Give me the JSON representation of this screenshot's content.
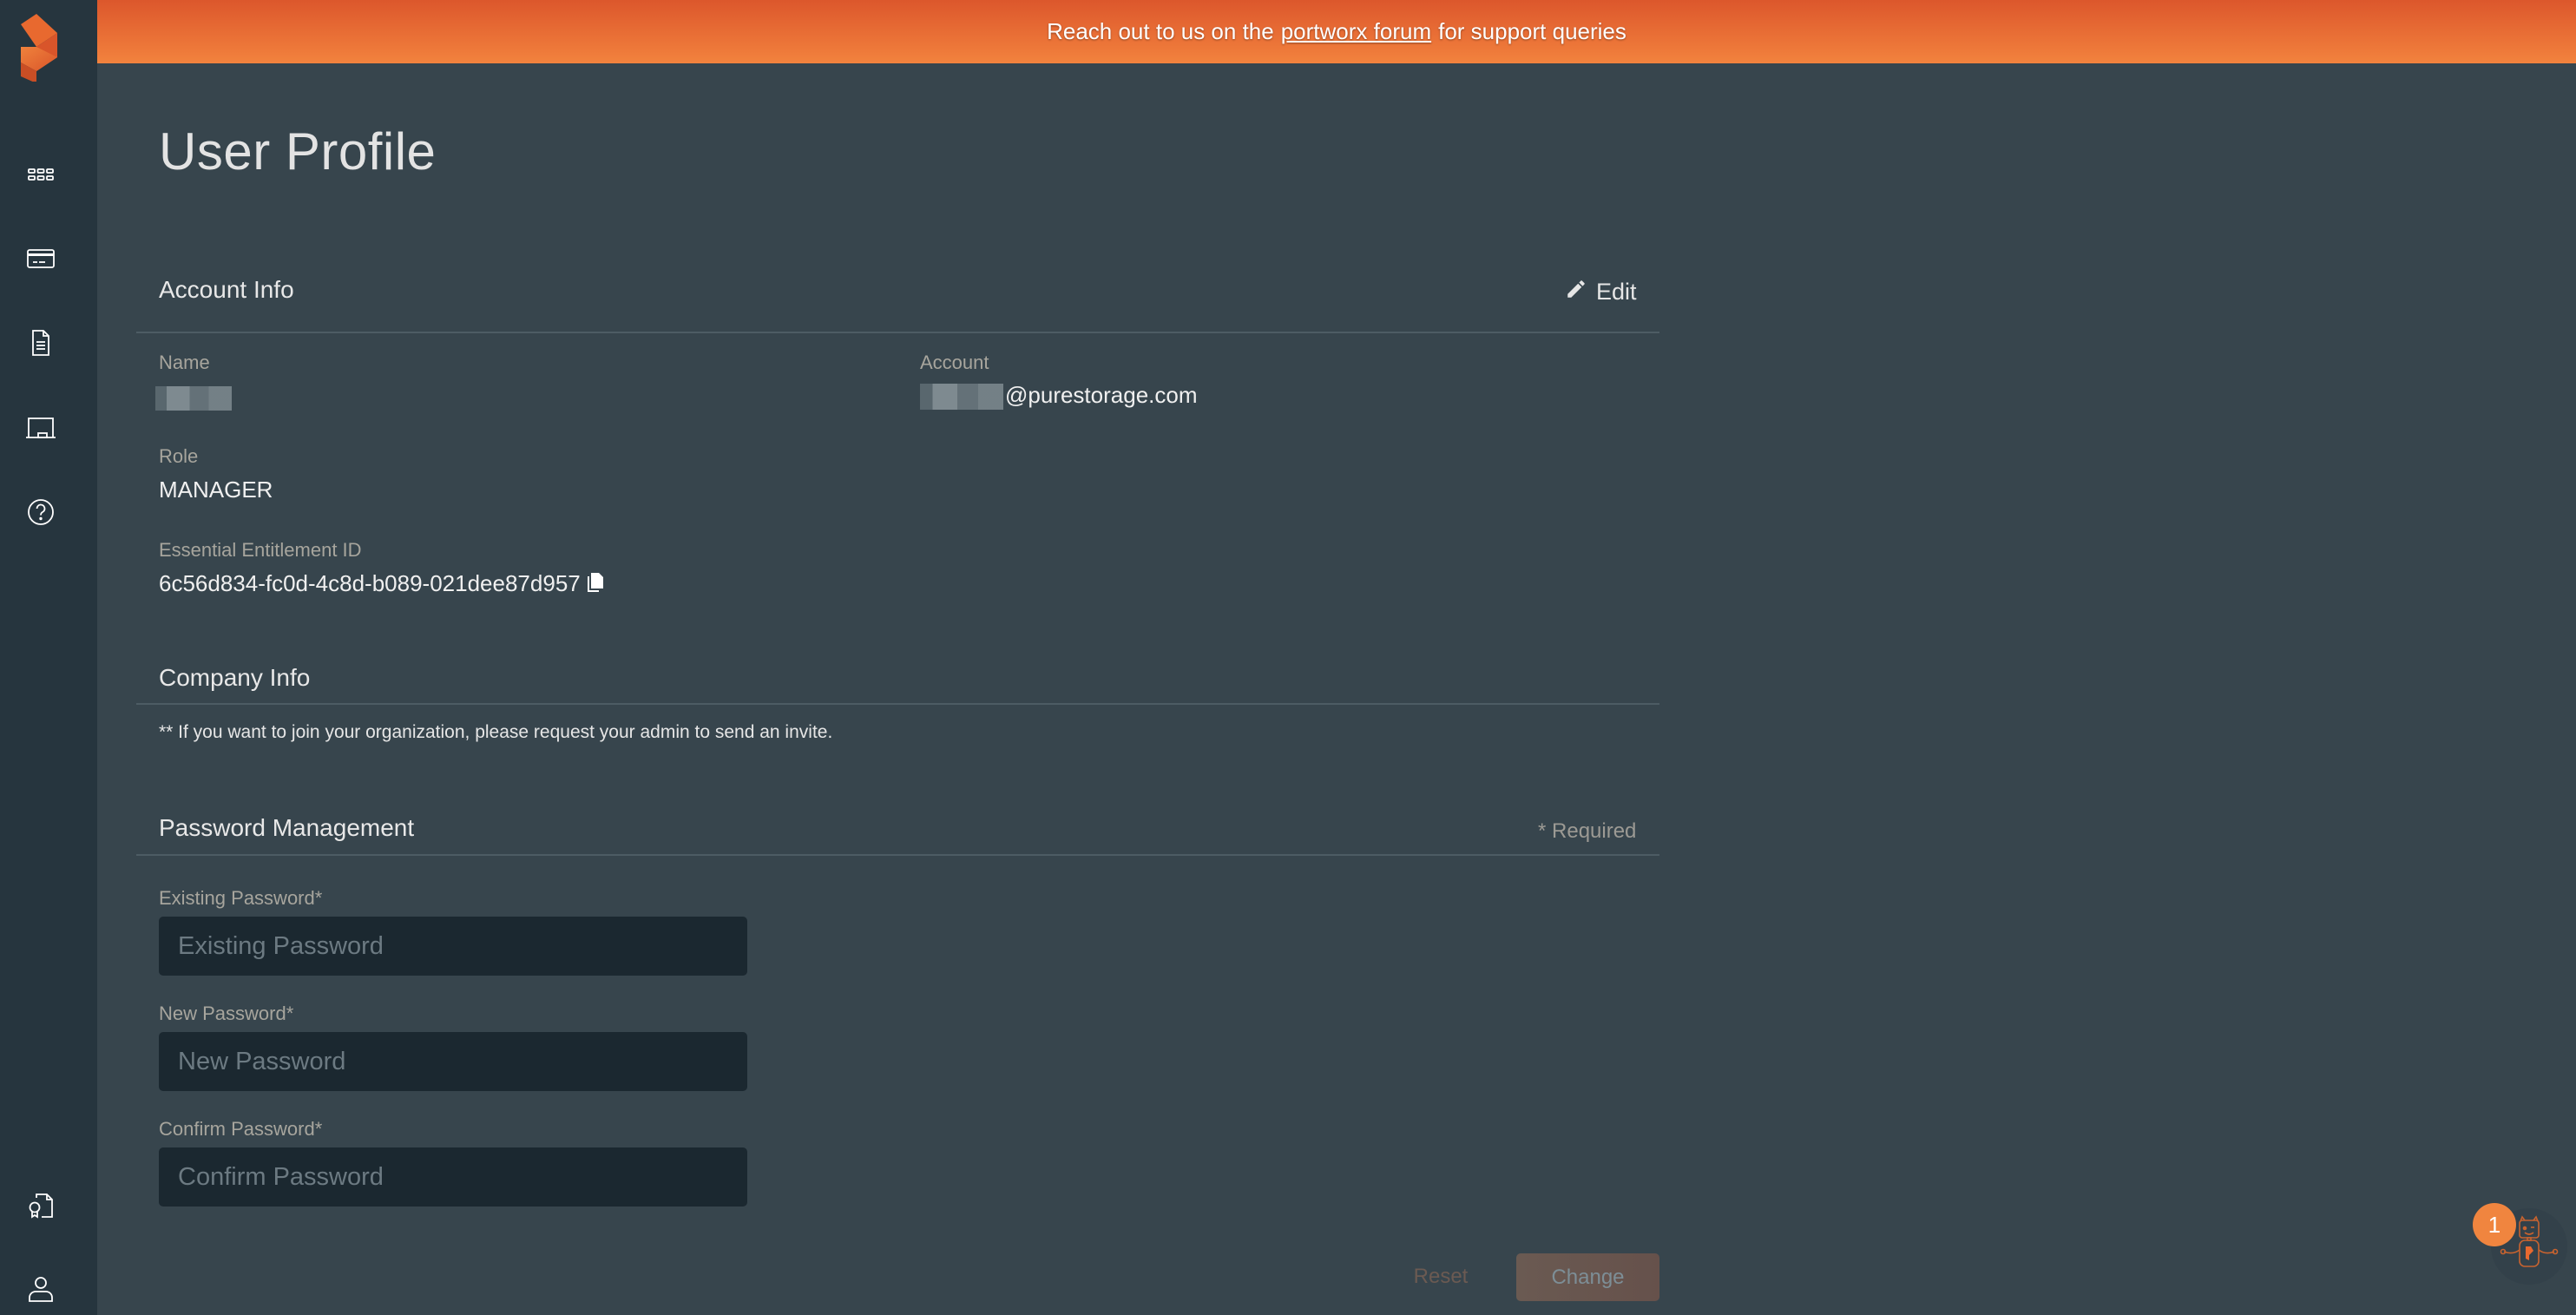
{
  "banner": {
    "prefix": "Reach out to us on the",
    "link_label": "portworx forum",
    "suffix": "for support queries"
  },
  "sidebar": {
    "items": [
      {
        "icon": "apps-grid-icon",
        "name": "sidebar-item-apps"
      },
      {
        "icon": "credit-card-icon",
        "name": "sidebar-item-billing"
      },
      {
        "icon": "document-icon",
        "name": "sidebar-item-documents"
      },
      {
        "icon": "presentation-board-icon",
        "name": "sidebar-item-training"
      },
      {
        "icon": "help-circle-icon",
        "name": "sidebar-item-help"
      }
    ],
    "bottom_items": [
      {
        "icon": "certificate-icon",
        "name": "sidebar-item-licenses"
      },
      {
        "icon": "user-icon",
        "name": "sidebar-item-profile"
      }
    ]
  },
  "page": {
    "title": "User Profile"
  },
  "account_info": {
    "heading": "Account Info",
    "edit_label": "Edit",
    "name_label": "Name",
    "name_value": "",
    "account_label": "Account",
    "account_value_suffix": "@purestorage.com",
    "role_label": "Role",
    "role_value": "MANAGER",
    "entitlement_label": "Essential Entitlement ID",
    "entitlement_value": "6c56d834-fc0d-4c8d-b089-021dee87d957"
  },
  "company_info": {
    "heading": "Company Info",
    "note": "** If you want to join your organization, please request your admin to send an invite."
  },
  "password_management": {
    "heading": "Password Management",
    "required_note": "* Required",
    "fields": [
      {
        "label": "Existing Password*",
        "placeholder": "Existing Password",
        "value": ""
      },
      {
        "label": "New Password*",
        "placeholder": "New Password",
        "value": ""
      },
      {
        "label": "Confirm Password*",
        "placeholder": "Confirm Password",
        "value": ""
      }
    ],
    "reset_label": "Reset",
    "change_label": "Change"
  },
  "chat": {
    "badge_count": "1"
  },
  "colors": {
    "accent": "#f0853f",
    "sidebar_bg": "#26353e",
    "main_bg": "#37454d",
    "input_bg": "#1b2830"
  }
}
